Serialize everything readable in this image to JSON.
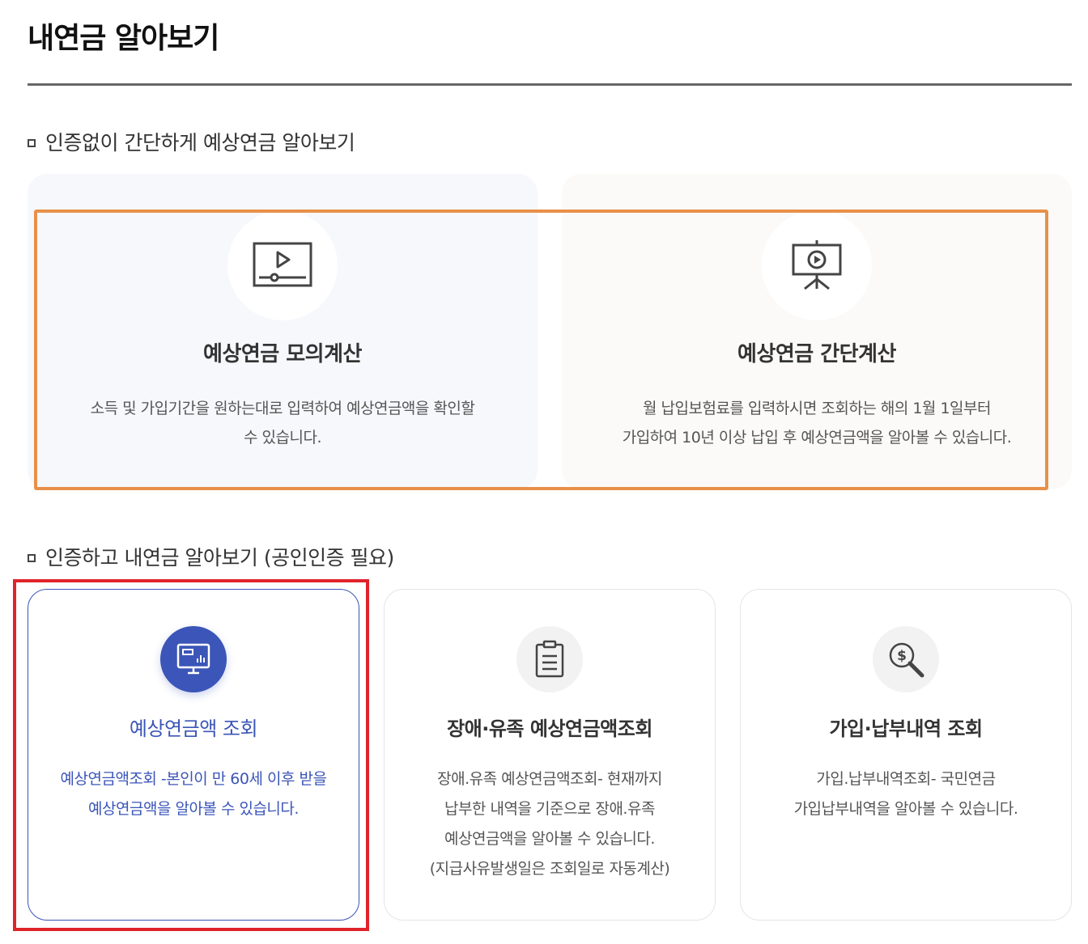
{
  "page": {
    "title": "내연금 알아보기"
  },
  "section_no_auth": {
    "heading": "인증없이 간단하게 예상연금 알아보기",
    "cards": [
      {
        "title": "예상연금 모의계산",
        "desc_lines": [
          "소득 및 가입기간을 원하는대로 입력하여 예상연금액을 확인할",
          "수 있습니다."
        ],
        "icon": "video-player-icon"
      },
      {
        "title": "예상연금 간단계산",
        "desc_lines": [
          "월 납입보험료를 입력하시면 조회하는 해의 1월 1일부터",
          "가입하여 10년 이상 납입 후 예상연금액을 알아볼 수 있습니다."
        ],
        "icon": "presentation-screen-icon"
      }
    ]
  },
  "section_auth": {
    "heading": "인증하고 내연금 알아보기 (공인인증 필요)",
    "cards": [
      {
        "title": "예상연금액 조회",
        "desc_lines": [
          "예상연금액조회 -본인이 만 60세 이후 받을",
          "예상연금액을 알아볼 수 있습니다."
        ],
        "icon": "monitor-chart-icon"
      },
      {
        "title": "장애·유족 예상연금액조회",
        "desc_lines": [
          "장애.유족 예상연금액조회- 현재까지",
          "납부한 내역을 기준으로 장애.유족",
          "예상연금액을 알아볼 수 있습니다.",
          "(지급사유발생일은 조회일로 자동계산)"
        ],
        "icon": "clipboard-list-icon"
      },
      {
        "title": "가입·납부내역 조회",
        "desc_lines": [
          "가입.납부내역조회- 국민연금",
          "가입납부내역을 알아볼 수 있습니다."
        ],
        "icon": "dollar-search-icon"
      }
    ]
  },
  "colors": {
    "accent": "#3b55b8",
    "highlight_orange": "#e8904a",
    "highlight_red": "#e0232b"
  }
}
